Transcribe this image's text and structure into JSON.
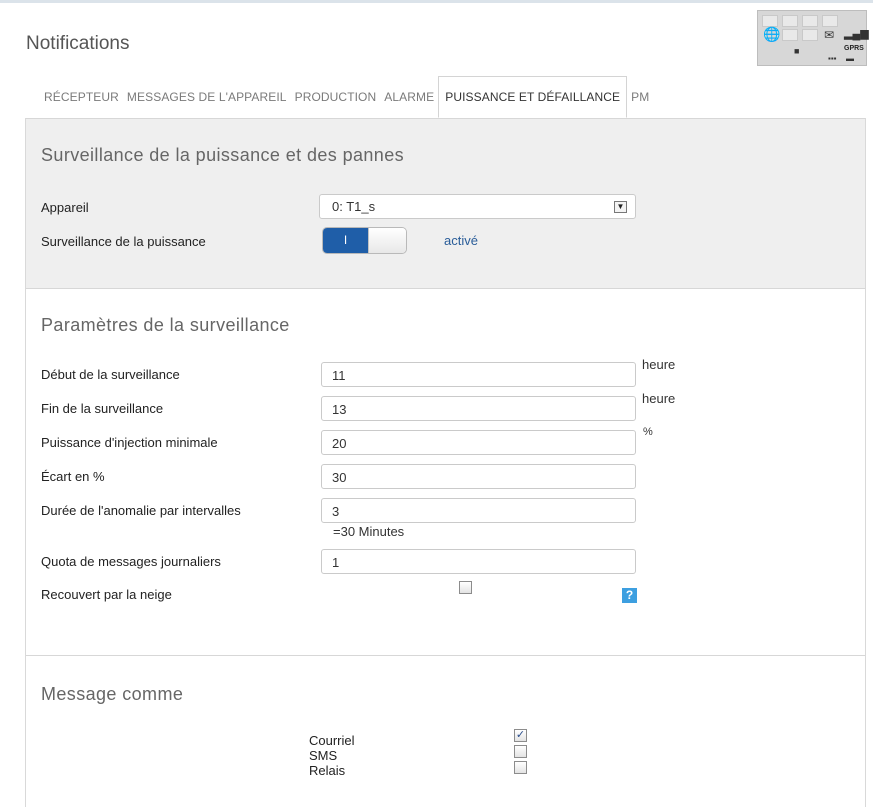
{
  "page": {
    "title": "Notifications"
  },
  "device_display": {
    "network_label": "GPRS"
  },
  "tabs": [
    {
      "label": "RÉCEPTEUR",
      "active": false
    },
    {
      "label": "MESSAGES DE L'APPAREIL",
      "active": false
    },
    {
      "label": "PRODUCTION",
      "active": false
    },
    {
      "label": "ALARME",
      "active": false
    },
    {
      "label": "PUISSANCE ET DÉFAILLANCE",
      "active": true
    },
    {
      "label": "PM",
      "active": false
    }
  ],
  "power_monitoring": {
    "title": "Surveillance de la puissance et des pannes",
    "device_label": "Appareil",
    "device_value": "0: T1_s",
    "monitoring_label": "Surveillance de la puissance",
    "toggle_on_text": "I",
    "toggle_state": "activé"
  },
  "monitoring_params": {
    "title": "Paramètres de la surveillance",
    "fields": [
      {
        "label": "Début de la surveillance",
        "value": "11",
        "unit": "heure"
      },
      {
        "label": "Fin de la surveillance",
        "value": "13",
        "unit": "heure"
      },
      {
        "label": "Puissance d'injection minimale",
        "value": "20",
        "unit": "%"
      },
      {
        "label": "Écart en %",
        "value": "30",
        "unit": ""
      },
      {
        "label": "Durée de l'anomalie par intervalles",
        "value": "3",
        "unit": "",
        "hint": "=30 Minutes"
      },
      {
        "label": "Quota de messages journaliers",
        "value": "1",
        "unit": ""
      }
    ],
    "snow_label": "Recouvert par la neige",
    "snow_checked": false,
    "help_text": "?"
  },
  "message_as": {
    "title": "Message comme",
    "options": [
      {
        "label": "Courriel",
        "checked": true
      },
      {
        "label": "SMS",
        "checked": false
      },
      {
        "label": "Relais",
        "checked": false
      }
    ],
    "check_mark": "✓"
  },
  "colors": {
    "toggle_on": "#1f5ea8",
    "link_state": "#2a5d99",
    "help_badge": "#3d9fe0",
    "section_gray": "#efefef"
  }
}
